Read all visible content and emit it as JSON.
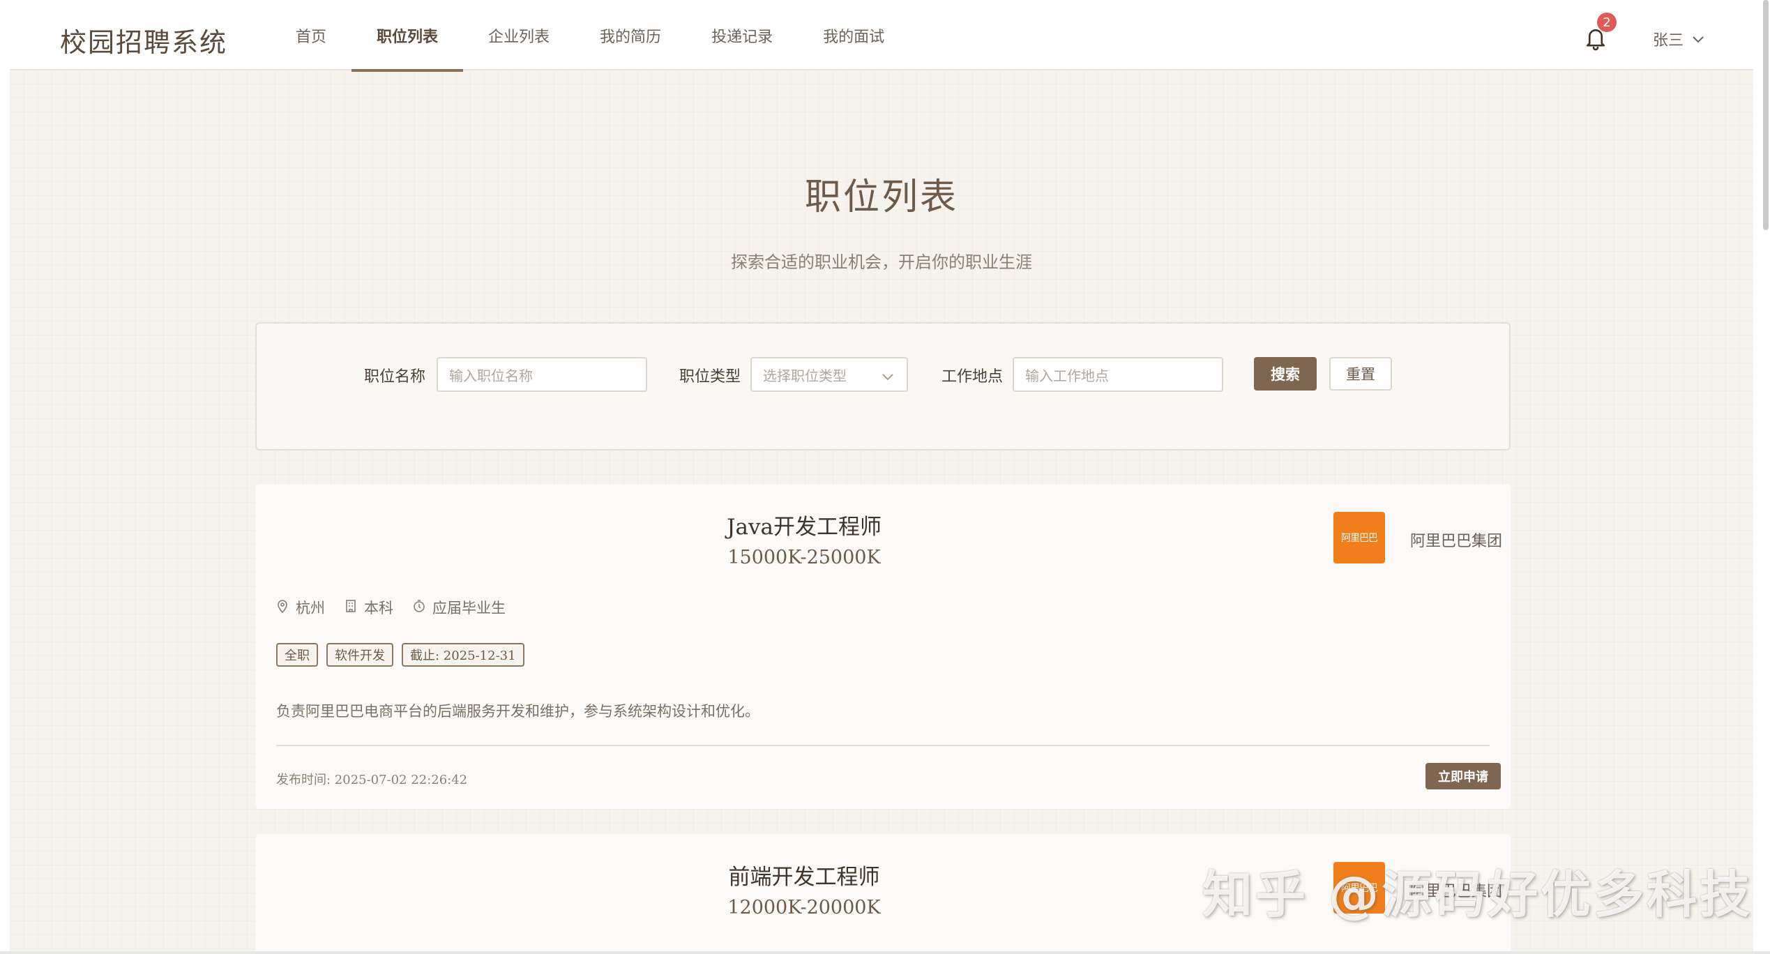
{
  "app": {
    "title": "校园招聘系统"
  },
  "nav": {
    "items": [
      {
        "label": "首页",
        "active": false
      },
      {
        "label": "职位列表",
        "active": true
      },
      {
        "label": "企业列表",
        "active": false
      },
      {
        "label": "我的简历",
        "active": false
      },
      {
        "label": "投递记录",
        "active": false
      },
      {
        "label": "我的面试",
        "active": false
      }
    ]
  },
  "header": {
    "notification_count": "2",
    "user_name": "张三",
    "icons": {
      "bell": "bell-icon",
      "user_menu": "chevron-down-icon"
    }
  },
  "hero": {
    "title": "职位列表",
    "subtitle": "探索合适的职业机会，开启你的职业生涯"
  },
  "search": {
    "job_name_label": "职位名称",
    "job_name_placeholder": "输入职位名称",
    "job_type_label": "职位类型",
    "job_type_placeholder": "选择职位类型",
    "location_label": "工作地点",
    "location_placeholder": "输入工作地点",
    "search_button": "搜索",
    "reset_button": "重置"
  },
  "jobs": [
    {
      "title": "Java开发工程师",
      "salary": "15000K-25000K",
      "company": "阿里巴巴集团",
      "company_logo_text": "阿里巴巴",
      "location": "杭州",
      "education": "本科",
      "experience": "应届毕业生",
      "tags": [
        "全职",
        "软件开发",
        "截止: 2025-12-31"
      ],
      "description": "负责阿里巴巴电商平台的后端服务开发和维护，参与系统架构设计和优化。",
      "publish_time": "发布时间: 2025-07-02 22:26:42",
      "apply_button": "立即申请"
    },
    {
      "title": "前端开发工程师",
      "salary": "12000K-20000K",
      "company": "阿里巴巴集团",
      "company_logo_text": "阿里巴巴"
    }
  ],
  "watermark": "知乎 @源码好优多科技",
  "colors": {
    "accent": "#7f6650",
    "background": "#f6f3ee",
    "badge": "#e05a5a",
    "company_logo": "#f07f1b"
  }
}
